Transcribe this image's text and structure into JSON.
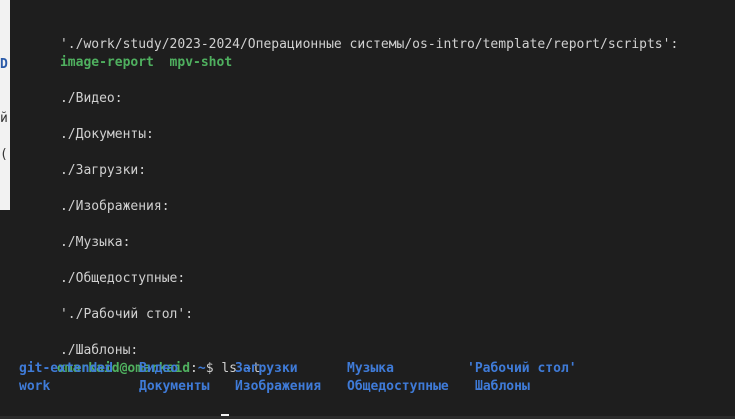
{
  "terminal": {
    "scripts_header": "'./work/study/2023-2024/Операционные системы/os-intro/template/report/scripts':",
    "scripts_entries": [
      "image-report",
      "mpv-shot"
    ],
    "dir_headers": [
      "./Видео:",
      "./Документы:",
      "./Загрузки:",
      "./Изображения:",
      "./Музыка:",
      "./Общедоступные:",
      "'./Рабочий стол':",
      "./Шаблоны:"
    ],
    "prompt_user": "omarkaid@omarkaid",
    "prompt_sep": ":",
    "prompt_path": "~",
    "prompt_symbol": "$",
    "command": "ls -t",
    "ls_row1": [
      "git-extended",
      "Видео",
      "Загрузки",
      "Музыка",
      "'Рабочий стол'"
    ],
    "ls_row2": [
      "work",
      "Документы",
      "Изображения",
      "Общедоступные",
      "Шаблоны"
    ]
  },
  "background_window": {
    "visible_glyphs": [
      "D",
      "й",
      "("
    ]
  },
  "colors": {
    "background": "#1e1e1e",
    "text": "#d0d0d0",
    "executable_green": "#4fb05f",
    "directory_blue": "#3f7bd8"
  }
}
